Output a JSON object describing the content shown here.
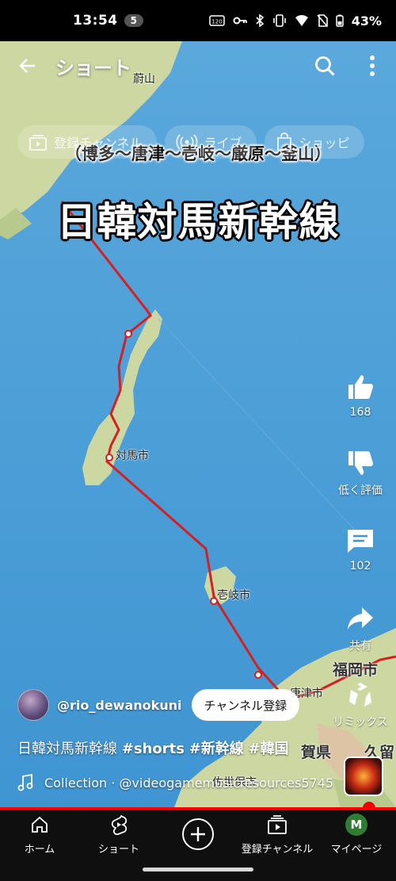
{
  "status_bar": {
    "time": "13:54",
    "notification_count": "5",
    "battery": "43%"
  },
  "header": {
    "title": "ショート"
  },
  "chips": [
    {
      "label": "登録チャンネル",
      "icon": "subscriptions-icon"
    },
    {
      "label": "ライブ",
      "icon": "live-icon"
    },
    {
      "label": "ショッピ",
      "icon": "shopping-bag-icon"
    }
  ],
  "video_overlay": {
    "route_caption": "（博多～唐津～壱岐～厳原～釜山）",
    "title": "日韓対馬新幹線",
    "map_labels": {
      "tsushima": "対馬市",
      "iki": "壱岐市",
      "fukuoka": "福岡市",
      "karatsu": "唐津市",
      "saga": "賀県",
      "kurume": "久留",
      "sasebo": "佐世保市",
      "busan_partial": "蔚山"
    }
  },
  "actions": {
    "like": {
      "label": "168",
      "icon": "thumbs-up-icon"
    },
    "dislike": {
      "label": "低く評価",
      "icon": "thumbs-down-icon"
    },
    "comments": {
      "label": "102",
      "icon": "comment-icon"
    },
    "share": {
      "label": "共有",
      "icon": "share-icon"
    },
    "remix": {
      "label": "リミックス",
      "icon": "remix-icon"
    }
  },
  "channel": {
    "handle": "@rio_dewanokuni",
    "subscribe_label": "チャンネル登録"
  },
  "description": {
    "text": "日韓対馬新幹線",
    "tags": [
      "#shorts",
      "#新幹線",
      "#韓国"
    ]
  },
  "music": {
    "text": "Collection · @videogamemusicresources5745"
  },
  "progress": {
    "fraction": 1.0
  },
  "bottom_nav": [
    {
      "label": "ホーム",
      "icon": "home-icon"
    },
    {
      "label": "ショート",
      "icon": "shorts-icon"
    },
    {
      "label": "",
      "icon": "create-plus-icon"
    },
    {
      "label": "登録チャンネル",
      "icon": "subscriptions-icon"
    },
    {
      "label": "マイページ",
      "icon": "avatar-icon",
      "avatar_letter": "M"
    }
  ],
  "colors": {
    "route": "#d42020",
    "sea": "#4f9fd6",
    "land": "#c9d6a0",
    "progress": "#ff0000",
    "nav_background": "#0f0f0f"
  }
}
